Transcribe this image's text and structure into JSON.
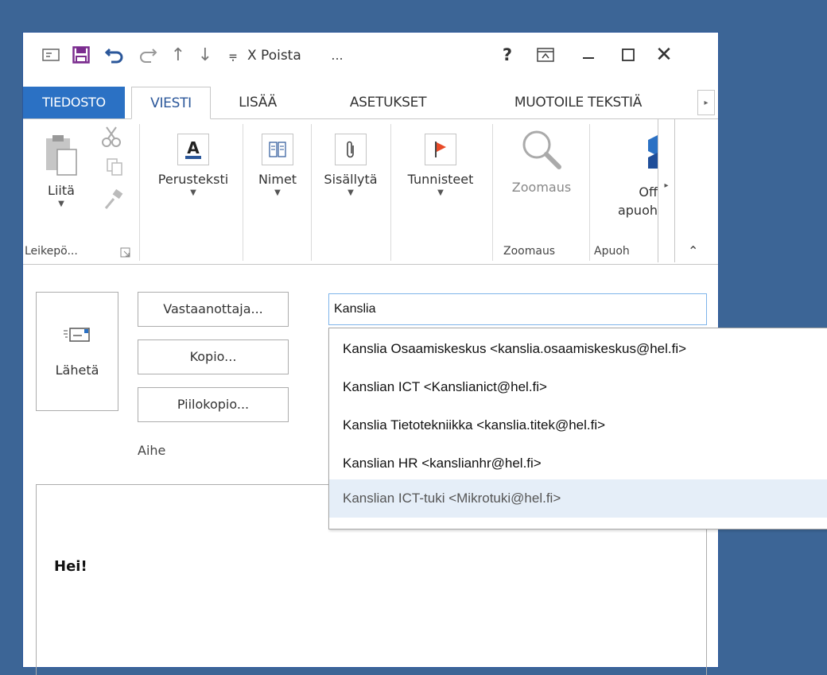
{
  "qat": {
    "delete_label": "X Poista",
    "ellipsis": "...",
    "help": "?"
  },
  "tabs": {
    "file": "TIEDOSTO",
    "message": "VIESTI",
    "insert": "LISÄÄ",
    "options": "ASETUKSET",
    "format_text": "MUOTOILE TEKSTIÄ"
  },
  "ribbon": {
    "paste": "Liitä",
    "clipboard_group": "Leikepö...",
    "basic_text": "Perusteksti",
    "names": "Nimet",
    "include": "Sisällytä",
    "tags": "Tunnisteet",
    "zoom": "Zoomaus",
    "zoom_group": "Zoomaus",
    "office_addins_line1": "Off",
    "office_addins_line2": "apuoh",
    "addins_group": "Apuoh"
  },
  "compose": {
    "send": "Lähetä",
    "to": "Vastaanottaja...",
    "cc": "Kopio...",
    "bcc": "Piilokopio...",
    "subject": "Aihe",
    "to_value": "Kanslia",
    "body_text": "Hei!"
  },
  "suggestions": [
    "Kanslia Osaamiskeskus <kanslia.osaamiskeskus@hel.fi>",
    "Kanslian ICT <Kanslianict@hel.fi>",
    "Kanslia Tietotekniikka <kanslia.titek@hel.fi>",
    "Kanslian HR <kanslianhr@hel.fi>",
    "Kanslian ICT-tuki <Mikrotuki@hel.fi>"
  ],
  "colors": {
    "desktop": "#3c6596",
    "accent": "#2b579a",
    "file_tab": "#2b71c4",
    "selected_suggestion": "#e5eef8"
  }
}
